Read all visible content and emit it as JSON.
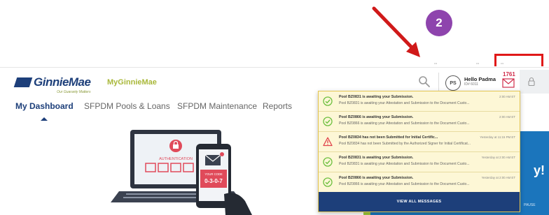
{
  "annotation": {
    "step_number": "2"
  },
  "header": {
    "logo_name": "GinnieMae",
    "logo_tagline": "Our Guaranty Matters",
    "brand": "MyGinnieMae",
    "avatar_initials": "PS",
    "greeting": "Hello Padma",
    "user_id": "ID# 6011",
    "mail_count": "1761"
  },
  "nav": {
    "items": [
      {
        "label": "My Dashboard",
        "active": true
      },
      {
        "label": "SFPDM Pools & Loans",
        "active": false
      },
      {
        "label": "SFPDM Maintenance",
        "active": false
      },
      {
        "label": "Reports",
        "active": false
      }
    ]
  },
  "illustration": {
    "screen_label": "AUTHENTICATION",
    "code_label": "YOUR CODE",
    "code_value": "0-3-0-7"
  },
  "notifications": {
    "items": [
      {
        "type": "success",
        "title": "Pool BZ0831 is awaiting your Submission.",
        "time": "2:00 AM ET",
        "body": "Pool BZ0831 is awaiting your Attestation and Submission to the Document Custo..."
      },
      {
        "type": "success",
        "title": "Pool BZ0866 is awaiting your Submission.",
        "time": "2:00 AM ET",
        "body": "Pool BZ0866 is awaiting your Attestation and Submission to the Document Custo..."
      },
      {
        "type": "warning",
        "title": "Pool BZ0834 has not been Submitted for Initial Certific...",
        "time": "Yesterday at 11:15 PM ET",
        "body": "Pool BZ0834 has not been Submitted by the Authorized Signer for Initial Certificat..."
      },
      {
        "type": "success",
        "title": "Pool BZ0831 is awaiting your Submission.",
        "time": "Yesterday at 2:00 AM ET",
        "body": "Pool BZ0831 is awaiting your Attestation and Submission to the Document Custo..."
      },
      {
        "type": "success",
        "title": "Pool BZ0866 is awaiting your Submission.",
        "time": "Yesterday at 2:00 AM ET",
        "body": "Pool BZ0866 is awaiting your Attestation and Submission to the Document Custo..."
      }
    ],
    "view_all_label": "VIEW ALL MESSAGES"
  },
  "background": {
    "banner_fragment": "y!",
    "pause_label": "PAUSE"
  },
  "colors": {
    "navy": "#1d3f7a",
    "success": "#6cbf3f",
    "warning": "#e0434b",
    "notif_bg": "#fdf7d6",
    "accent_red": "#e01818",
    "badge_purple": "#8e44ad"
  },
  "icons": {
    "search": "search-icon",
    "mail": "mail-icon",
    "lock": "lock-icon",
    "success": "check-circle-icon",
    "warning": "warning-triangle-icon"
  }
}
